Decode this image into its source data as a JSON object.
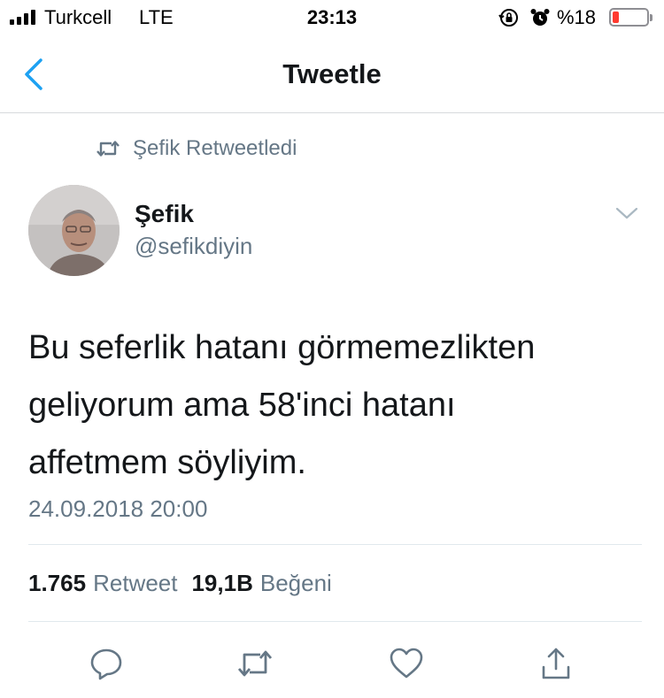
{
  "status_bar": {
    "carrier": "Turkcell",
    "network": "LTE",
    "time": "23:13",
    "battery_percent": "%18",
    "battery_level": 0.18,
    "battery_color": "#ff3b30",
    "icons": [
      "signal-bars-icon",
      "rotation-lock-icon",
      "alarm-icon",
      "battery-icon"
    ]
  },
  "nav": {
    "title": "Tweetle",
    "back_icon": "chevron-left-icon",
    "accent": "#1da1f2"
  },
  "retweet_context": {
    "icon": "retweet-icon",
    "text": "Şefik Retweetledi"
  },
  "author": {
    "name": "Şefik",
    "handle": "@sefikdiyin",
    "menu_icon": "chevron-down-icon"
  },
  "tweet": {
    "lines": [
      "Bu seferlik hatanı görmemezlikten",
      "geliyorum ama 58'inci hatanı",
      "affetmem söyliyim."
    ],
    "timestamp": "24.09.2018 20:00"
  },
  "stats": {
    "retweets": "1.765",
    "retweets_label": "Retweet",
    "likes": "19,1B",
    "likes_label": "Beğeni"
  },
  "actions": [
    "reply-icon",
    "retweet-icon",
    "like-icon",
    "share-icon"
  ],
  "colors": {
    "text": "#14171a",
    "secondary": "#657786",
    "divider": "#e1e8ed"
  }
}
